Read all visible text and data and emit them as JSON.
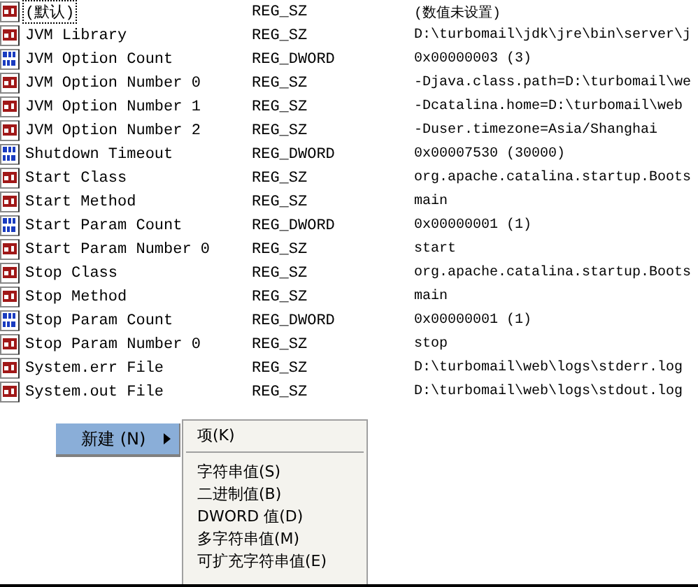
{
  "values": [
    {
      "name": "(默认)",
      "type": "REG_SZ",
      "data": "(数值未设置)",
      "kind": "sz",
      "selected": true
    },
    {
      "name": "JVM Library",
      "type": "REG_SZ",
      "data": "D:\\turbomail\\jdk\\jre\\bin\\server\\j",
      "kind": "sz",
      "selected": false
    },
    {
      "name": "JVM Option Count",
      "type": "REG_DWORD",
      "data": "0x00000003 (3)",
      "kind": "dword",
      "selected": false
    },
    {
      "name": "JVM Option Number 0",
      "type": "REG_SZ",
      "data": "-Djava.class.path=D:\\turbomail\\we",
      "kind": "sz",
      "selected": false
    },
    {
      "name": "JVM Option Number 1",
      "type": "REG_SZ",
      "data": "-Dcatalina.home=D:\\turbomail\\web",
      "kind": "sz",
      "selected": false
    },
    {
      "name": "JVM Option Number 2",
      "type": "REG_SZ",
      "data": "-Duser.timezone=Asia/Shanghai",
      "kind": "sz",
      "selected": false
    },
    {
      "name": "Shutdown Timeout",
      "type": "REG_DWORD",
      "data": "0x00007530 (30000)",
      "kind": "dword",
      "selected": false
    },
    {
      "name": "Start Class",
      "type": "REG_SZ",
      "data": "org.apache.catalina.startup.Boots",
      "kind": "sz",
      "selected": false
    },
    {
      "name": "Start Method",
      "type": "REG_SZ",
      "data": "main",
      "kind": "sz",
      "selected": false
    },
    {
      "name": "Start Param Count",
      "type": "REG_DWORD",
      "data": "0x00000001 (1)",
      "kind": "dword",
      "selected": false
    },
    {
      "name": "Start Param Number 0",
      "type": "REG_SZ",
      "data": "start",
      "kind": "sz",
      "selected": false
    },
    {
      "name": "Stop Class",
      "type": "REG_SZ",
      "data": "org.apache.catalina.startup.Boots",
      "kind": "sz",
      "selected": false
    },
    {
      "name": "Stop Method",
      "type": "REG_SZ",
      "data": "main",
      "kind": "sz",
      "selected": false
    },
    {
      "name": "Stop Param Count",
      "type": "REG_DWORD",
      "data": "0x00000001 (1)",
      "kind": "dword",
      "selected": false
    },
    {
      "name": "Stop Param Number 0",
      "type": "REG_SZ",
      "data": "stop",
      "kind": "sz",
      "selected": false
    },
    {
      "name": "System.err File",
      "type": "REG_SZ",
      "data": "D:\\turbomail\\web\\logs\\stderr.log",
      "kind": "sz",
      "selected": false
    },
    {
      "name": "System.out File",
      "type": "REG_SZ",
      "data": "D:\\turbomail\\web\\logs\\stdout.log",
      "kind": "sz",
      "selected": false
    }
  ],
  "context_menu": {
    "items": [
      {
        "label": "新建 (N)",
        "selected": true
      }
    ]
  },
  "submenu": {
    "items": [
      {
        "label": "项(K)",
        "kind": "item"
      },
      {
        "kind": "separator"
      },
      {
        "label": "字符串值(S)",
        "kind": "item"
      },
      {
        "label": "二进制值(B)",
        "kind": "item"
      },
      {
        "label": "DWORD 值(D)",
        "kind": "item"
      },
      {
        "label": "多字符串值(M)",
        "kind": "item"
      },
      {
        "label": "可扩充字符串值(E)",
        "kind": "item"
      }
    ]
  }
}
